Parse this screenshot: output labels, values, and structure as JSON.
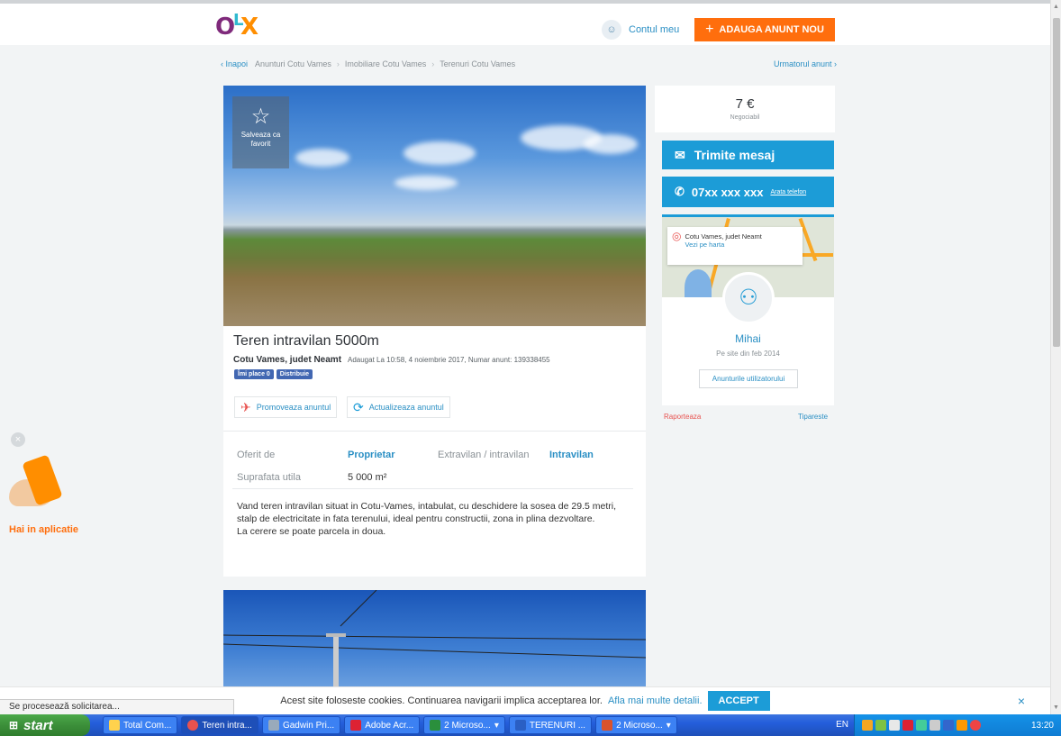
{
  "header": {
    "logo": {
      "o": "O",
      "l": "L",
      "x": "X"
    },
    "account_label": "Contul meu",
    "post_button_label": "ADAUGA ANUNT NOU"
  },
  "breadcrumb": {
    "back": "Inapoi",
    "items": [
      "Anunturi Cotu Vames",
      "Imobiliare Cotu Vames",
      "Terenuri Cotu Vames"
    ],
    "next": "Urmatorul anunt"
  },
  "listing": {
    "favorite_label": "Salveaza ca favorit",
    "title": "Teren intravilan 5000m",
    "location": "Cotu Vames, judet Neamt",
    "added": "Adaugat La 10:58, 4 noiembrie 2017, Numar anunt: 139338455",
    "fb_like": "Îmi place 0",
    "fb_share": "Distribuie",
    "promote_label": "Promoveaza anuntul",
    "refresh_label": "Actualizeaza anuntul",
    "attributes": {
      "offered_by_label": "Oferit de",
      "offered_by_value": "Proprietar",
      "zone_label": "Extravilan / intravilan",
      "zone_value": "Intravilan",
      "area_label": "Suprafata utila",
      "area_value": "5 000 m²"
    },
    "description_1": "Vand teren intravilan situat in Cotu-Vames, intabulat, cu deschidere la sosea de 29.5 metri, stalp de electricitate in fata terenului, ideal pentru constructii, zona in plina dezvoltare.",
    "description_2": "La cerere se poate parcela in doua."
  },
  "sidebar": {
    "price": "7 €",
    "negotiable": "Negociabil",
    "message_button": "Trimite mesaj",
    "phone_number": "07xx xxx xxx",
    "show_phone": "Arata telefon",
    "map_location": "Cotu Vames, judet Neamt",
    "map_link": "Vezi pe harta",
    "user_name": "Mihai",
    "user_since": "Pe site din feb 2014",
    "user_ads": "Anunturile utilizatorului",
    "report": "Raporteaza",
    "print": "Tipareste"
  },
  "app_promo": {
    "text": "Hai in aplicatie"
  },
  "cookie_bar": {
    "text": "Acest site foloseste cookies. Continuarea navigarii implica acceptarea lor.",
    "more_link": "Afla mai multe detalii.",
    "accept": "ACCEPT"
  },
  "status_bar": {
    "text": "Se procesează solicitarea..."
  },
  "taskbar": {
    "start": "start",
    "tasks": [
      "Total Com...",
      "Teren intra...",
      "Gadwin Pri...",
      "Adobe Acr...",
      "2 Microso...",
      "TERENURI ...",
      "2 Microso..."
    ],
    "language": "EN",
    "clock": "13:20"
  },
  "colors": {
    "accent": "#1c9cd7",
    "orange": "#ff6e0d",
    "brand_purple": "#7f2a7b"
  }
}
